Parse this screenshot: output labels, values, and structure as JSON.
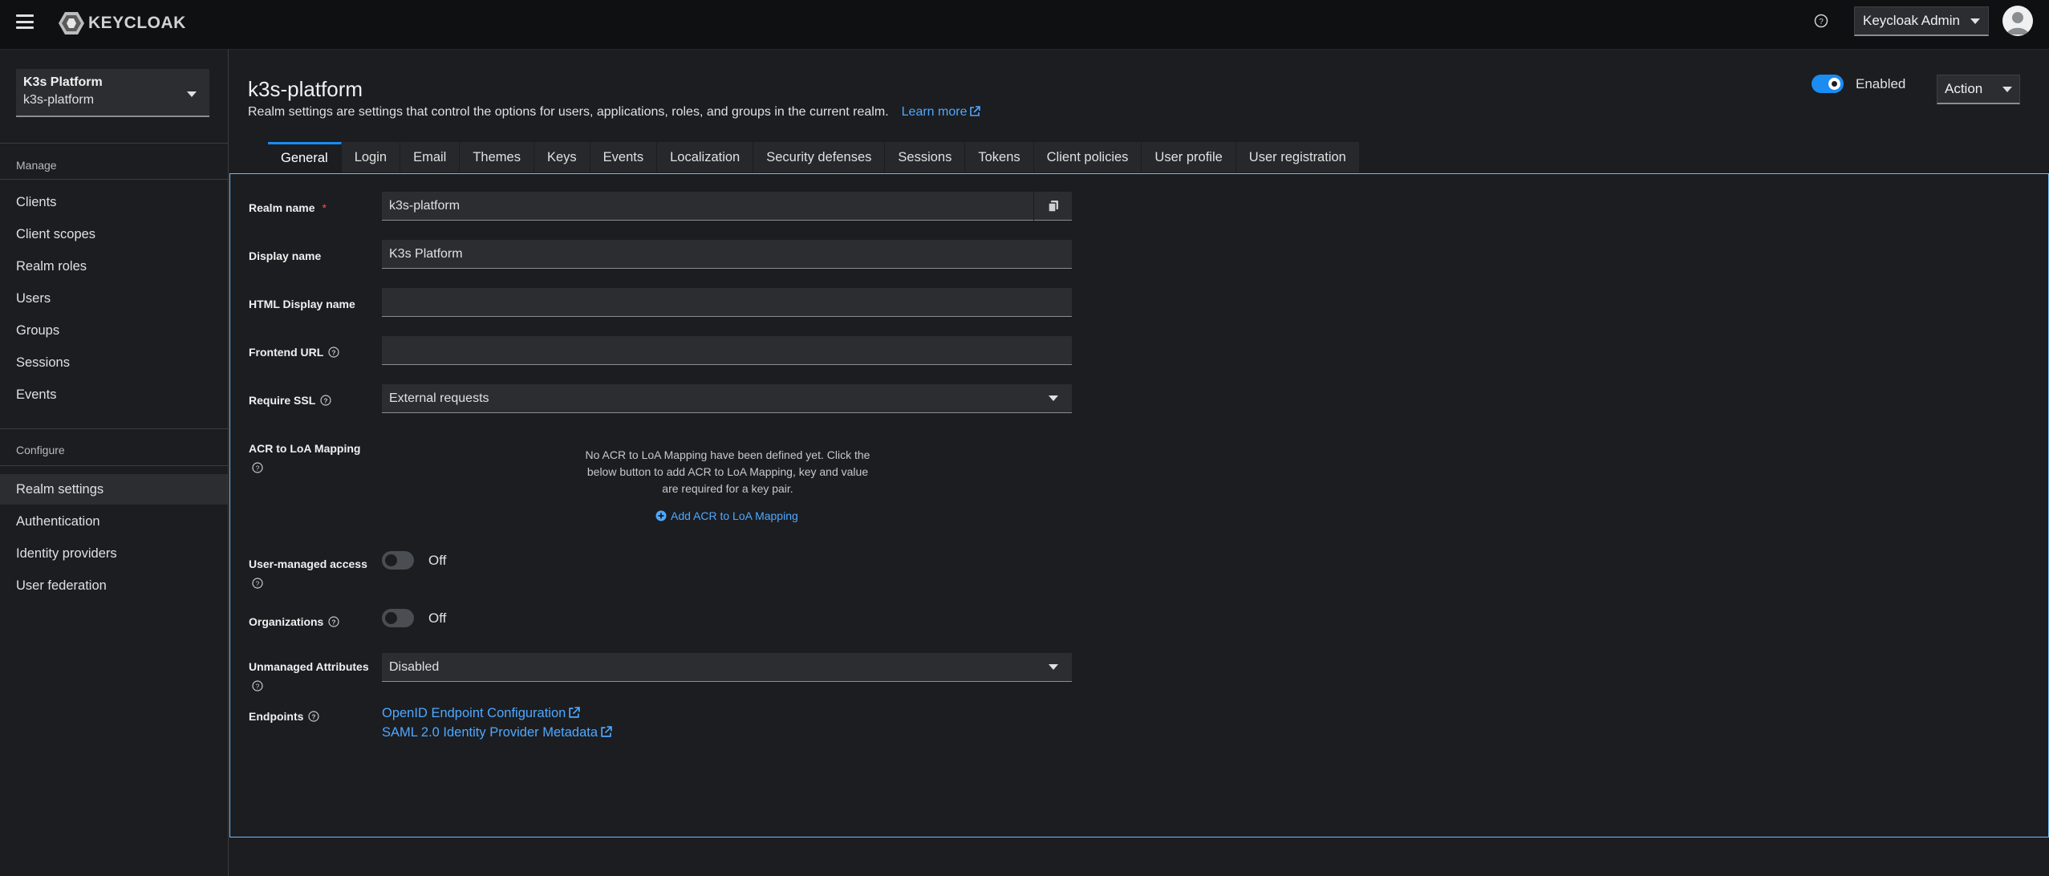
{
  "topbar": {
    "logo_text": "KEYCLOAK",
    "user_menu": "Keycloak Admin",
    "icons": [
      "hamburger-icon",
      "help-icon",
      "avatar-icon"
    ]
  },
  "sidebar": {
    "realm_display": "K3s Platform",
    "realm_id": "k3s-platform",
    "manage_label": "Manage",
    "manage_items": [
      {
        "label": "Clients"
      },
      {
        "label": "Client scopes"
      },
      {
        "label": "Realm roles"
      },
      {
        "label": "Users"
      },
      {
        "label": "Groups"
      },
      {
        "label": "Sessions"
      },
      {
        "label": "Events"
      }
    ],
    "configure_label": "Configure",
    "configure_items": [
      {
        "label": "Realm settings",
        "active": true
      },
      {
        "label": "Authentication"
      },
      {
        "label": "Identity providers"
      },
      {
        "label": "User federation"
      }
    ]
  },
  "header": {
    "title": "k3s-platform",
    "description": "Realm settings are settings that control the options for users, applications, roles, and groups in the current realm.",
    "learn_more": "Learn more",
    "enabled_label": "Enabled",
    "enabled": true,
    "action_label": "Action"
  },
  "tabs": [
    {
      "label": "General",
      "active": true
    },
    {
      "label": "Login"
    },
    {
      "label": "Email"
    },
    {
      "label": "Themes"
    },
    {
      "label": "Keys"
    },
    {
      "label": "Events"
    },
    {
      "label": "Localization"
    },
    {
      "label": "Security defenses"
    },
    {
      "label": "Sessions"
    },
    {
      "label": "Tokens"
    },
    {
      "label": "Client policies"
    },
    {
      "label": "User profile"
    },
    {
      "label": "User registration"
    }
  ],
  "form": {
    "realm_name_label": "Realm name",
    "realm_name_required": "*",
    "realm_name_value": "k3s-platform",
    "display_name_label": "Display name",
    "display_name_value": "K3s Platform",
    "html_display_name_label": "HTML Display name",
    "html_display_name_value": "",
    "frontend_url_label": "Frontend URL",
    "frontend_url_value": "",
    "require_ssl_label": "Require SSL",
    "require_ssl_value": "External requests",
    "acr_label": "ACR to LoA Mapping",
    "acr_empty": "No ACR to LoA Mapping have been defined yet. Click the below button to add ACR to LoA Mapping, key and value are required for a key pair.",
    "acr_add": "Add ACR to LoA Mapping",
    "uma_label": "User-managed access",
    "uma_state": "Off",
    "org_label": "Organizations",
    "org_state": "Off",
    "unmanaged_label": "Unmanaged Attributes",
    "unmanaged_value": "Disabled",
    "endpoints_label": "Endpoints",
    "endpoint_openid": "OpenID Endpoint Configuration",
    "endpoint_saml": "SAML 2.0 Identity Provider Metadata"
  },
  "colors": {
    "accent": "#1a8cf2",
    "link": "#4fa8ff",
    "bg": "#1b1d21",
    "topbar": "#0f1012"
  }
}
